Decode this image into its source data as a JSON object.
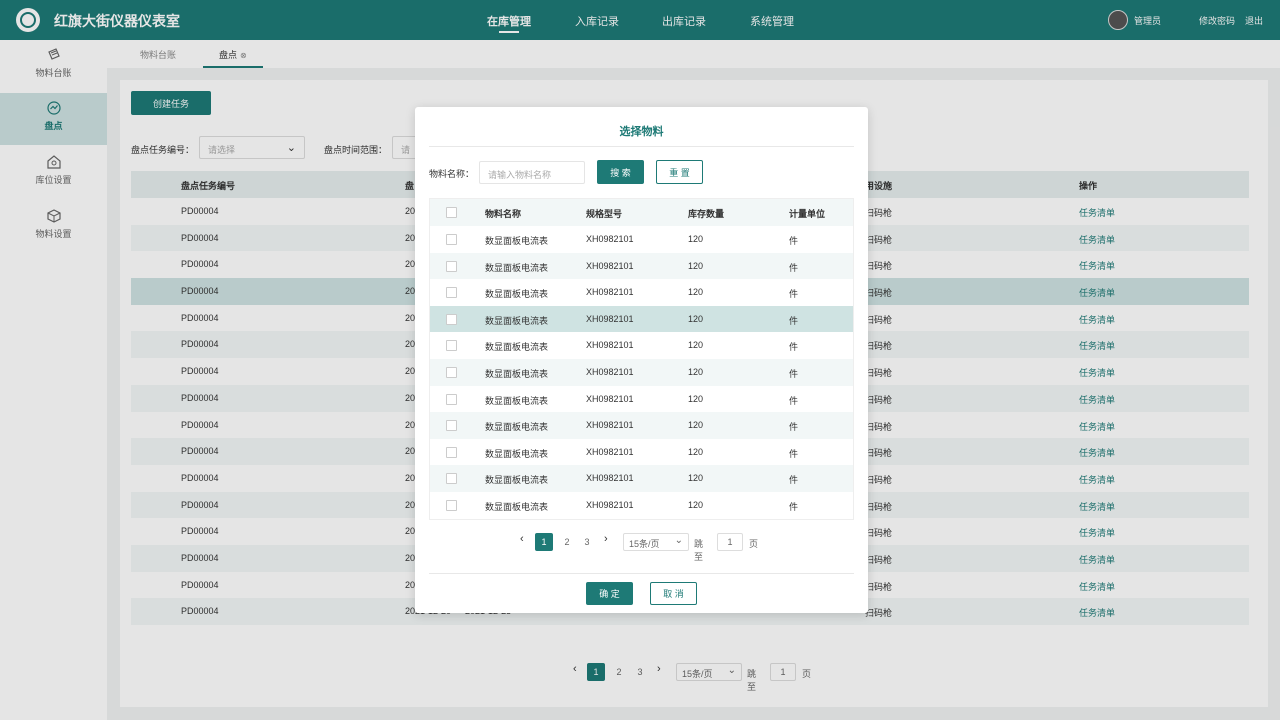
{
  "header": {
    "title": "红旗大街仪器仪表室",
    "nav": [
      "在库管理",
      "入库记录",
      "出库记录",
      "系统管理"
    ],
    "active_nav": "在库管理",
    "user_name": "管理员",
    "change_password": "修改密码",
    "logout": "退出"
  },
  "sidebar": {
    "items": [
      {
        "label": "物料台账",
        "icon": "ledger-icon"
      },
      {
        "label": "盘点",
        "icon": "inventory-check-icon"
      },
      {
        "label": "库位设置",
        "icon": "warehouse-icon"
      },
      {
        "label": "物料设置",
        "icon": "box-icon"
      }
    ],
    "active": "盘点"
  },
  "tabs": [
    {
      "label": "物料台账"
    },
    {
      "label": "盘点",
      "close": "⊗"
    }
  ],
  "main": {
    "create_button": "创建任务",
    "filters": {
      "task_code_label": "盘点任务编号：",
      "task_code_placeholder": "请选择",
      "time_range_label": "盘点时间范围：",
      "time_range_placeholder": "请"
    },
    "table": {
      "columns": [
        "盘点任务编号",
        "盘",
        "用设施",
        "操作"
      ],
      "rows": [
        {
          "code": "PD00004",
          "date": "20",
          "device": "扫码枪",
          "op": "任务清单"
        },
        {
          "code": "PD00004",
          "date": "20",
          "device": "扫码枪",
          "op": "任务清单"
        },
        {
          "code": "PD00004",
          "date": "20",
          "device": "扫码枪",
          "op": "任务清单"
        },
        {
          "code": "PD00004",
          "date": "20",
          "device": "扫码枪",
          "op": "任务清单"
        },
        {
          "code": "PD00004",
          "date": "20",
          "device": "扫码枪",
          "op": "任务清单"
        },
        {
          "code": "PD00004",
          "date": "20",
          "device": "扫码枪",
          "op": "任务清单"
        },
        {
          "code": "PD00004",
          "date": "20",
          "device": "扫码枪",
          "op": "任务清单"
        },
        {
          "code": "PD00004",
          "date": "20",
          "device": "扫码枪",
          "op": "任务清单"
        },
        {
          "code": "PD00004",
          "date": "20",
          "device": "扫码枪",
          "op": "任务清单"
        },
        {
          "code": "PD00004",
          "date": "20",
          "device": "扫码枪",
          "op": "任务清单"
        },
        {
          "code": "PD00004",
          "date": "20",
          "device": "扫码枪",
          "op": "任务清单"
        },
        {
          "code": "PD00004",
          "date": "20",
          "device": "扫码枪",
          "op": "任务清单"
        },
        {
          "code": "PD00004",
          "date": "20",
          "device": "扫码枪",
          "op": "任务清单"
        },
        {
          "code": "PD00004",
          "date": "20",
          "device": "扫码枪",
          "op": "任务清单"
        },
        {
          "code": "PD00004",
          "date": "20",
          "device": "扫码枪",
          "op": "任务清单"
        },
        {
          "code": "PD00004",
          "date": "2021-12-20  —  2021-12-25",
          "device": "扫码枪",
          "op": "任务清单"
        }
      ],
      "highlighted_row": 4
    },
    "pager": {
      "pages": [
        "1",
        "2",
        "3"
      ],
      "current": "1",
      "page_size": "15条/页",
      "jump_label": "跳至",
      "jump_value": "1",
      "unit": "页"
    }
  },
  "modal": {
    "title": "选择物料",
    "search_label": "物料名称：",
    "search_placeholder": "请输入物料名称",
    "search_button": "搜 索",
    "reset_button": "重 置",
    "columns": [
      "物料名称",
      "规格型号",
      "库存数量",
      "计量单位"
    ],
    "rows": [
      {
        "name": "数显面板电流表",
        "model": "XH0982101",
        "qty": "120",
        "unit": "件"
      },
      {
        "name": "数显面板电流表",
        "model": "XH0982101",
        "qty": "120",
        "unit": "件"
      },
      {
        "name": "数显面板电流表",
        "model": "XH0982101",
        "qty": "120",
        "unit": "件"
      },
      {
        "name": "数显面板电流表",
        "model": "XH0982101",
        "qty": "120",
        "unit": "件"
      },
      {
        "name": "数显面板电流表",
        "model": "XH0982101",
        "qty": "120",
        "unit": "件"
      },
      {
        "name": "数显面板电流表",
        "model": "XH0982101",
        "qty": "120",
        "unit": "件"
      },
      {
        "name": "数显面板电流表",
        "model": "XH0982101",
        "qty": "120",
        "unit": "件"
      },
      {
        "name": "数显面板电流表",
        "model": "XH0982101",
        "qty": "120",
        "unit": "件"
      },
      {
        "name": "数显面板电流表",
        "model": "XH0982101",
        "qty": "120",
        "unit": "件"
      },
      {
        "name": "数显面板电流表",
        "model": "XH0982101",
        "qty": "120",
        "unit": "件"
      },
      {
        "name": "数显面板电流表",
        "model": "XH0982101",
        "qty": "120",
        "unit": "件"
      }
    ],
    "highlighted_row": 4,
    "pager": {
      "pages": [
        "1",
        "2",
        "3"
      ],
      "current": "1",
      "page_size": "15条/页",
      "jump_label": "跳至",
      "jump_value": "1",
      "unit": "页"
    },
    "confirm_button": "确 定",
    "cancel_button": "取 消"
  },
  "colors": {
    "primary": "#1e7a76",
    "row_highlight": "#cfe3e2",
    "row_stripe": "#f2f7f7"
  }
}
